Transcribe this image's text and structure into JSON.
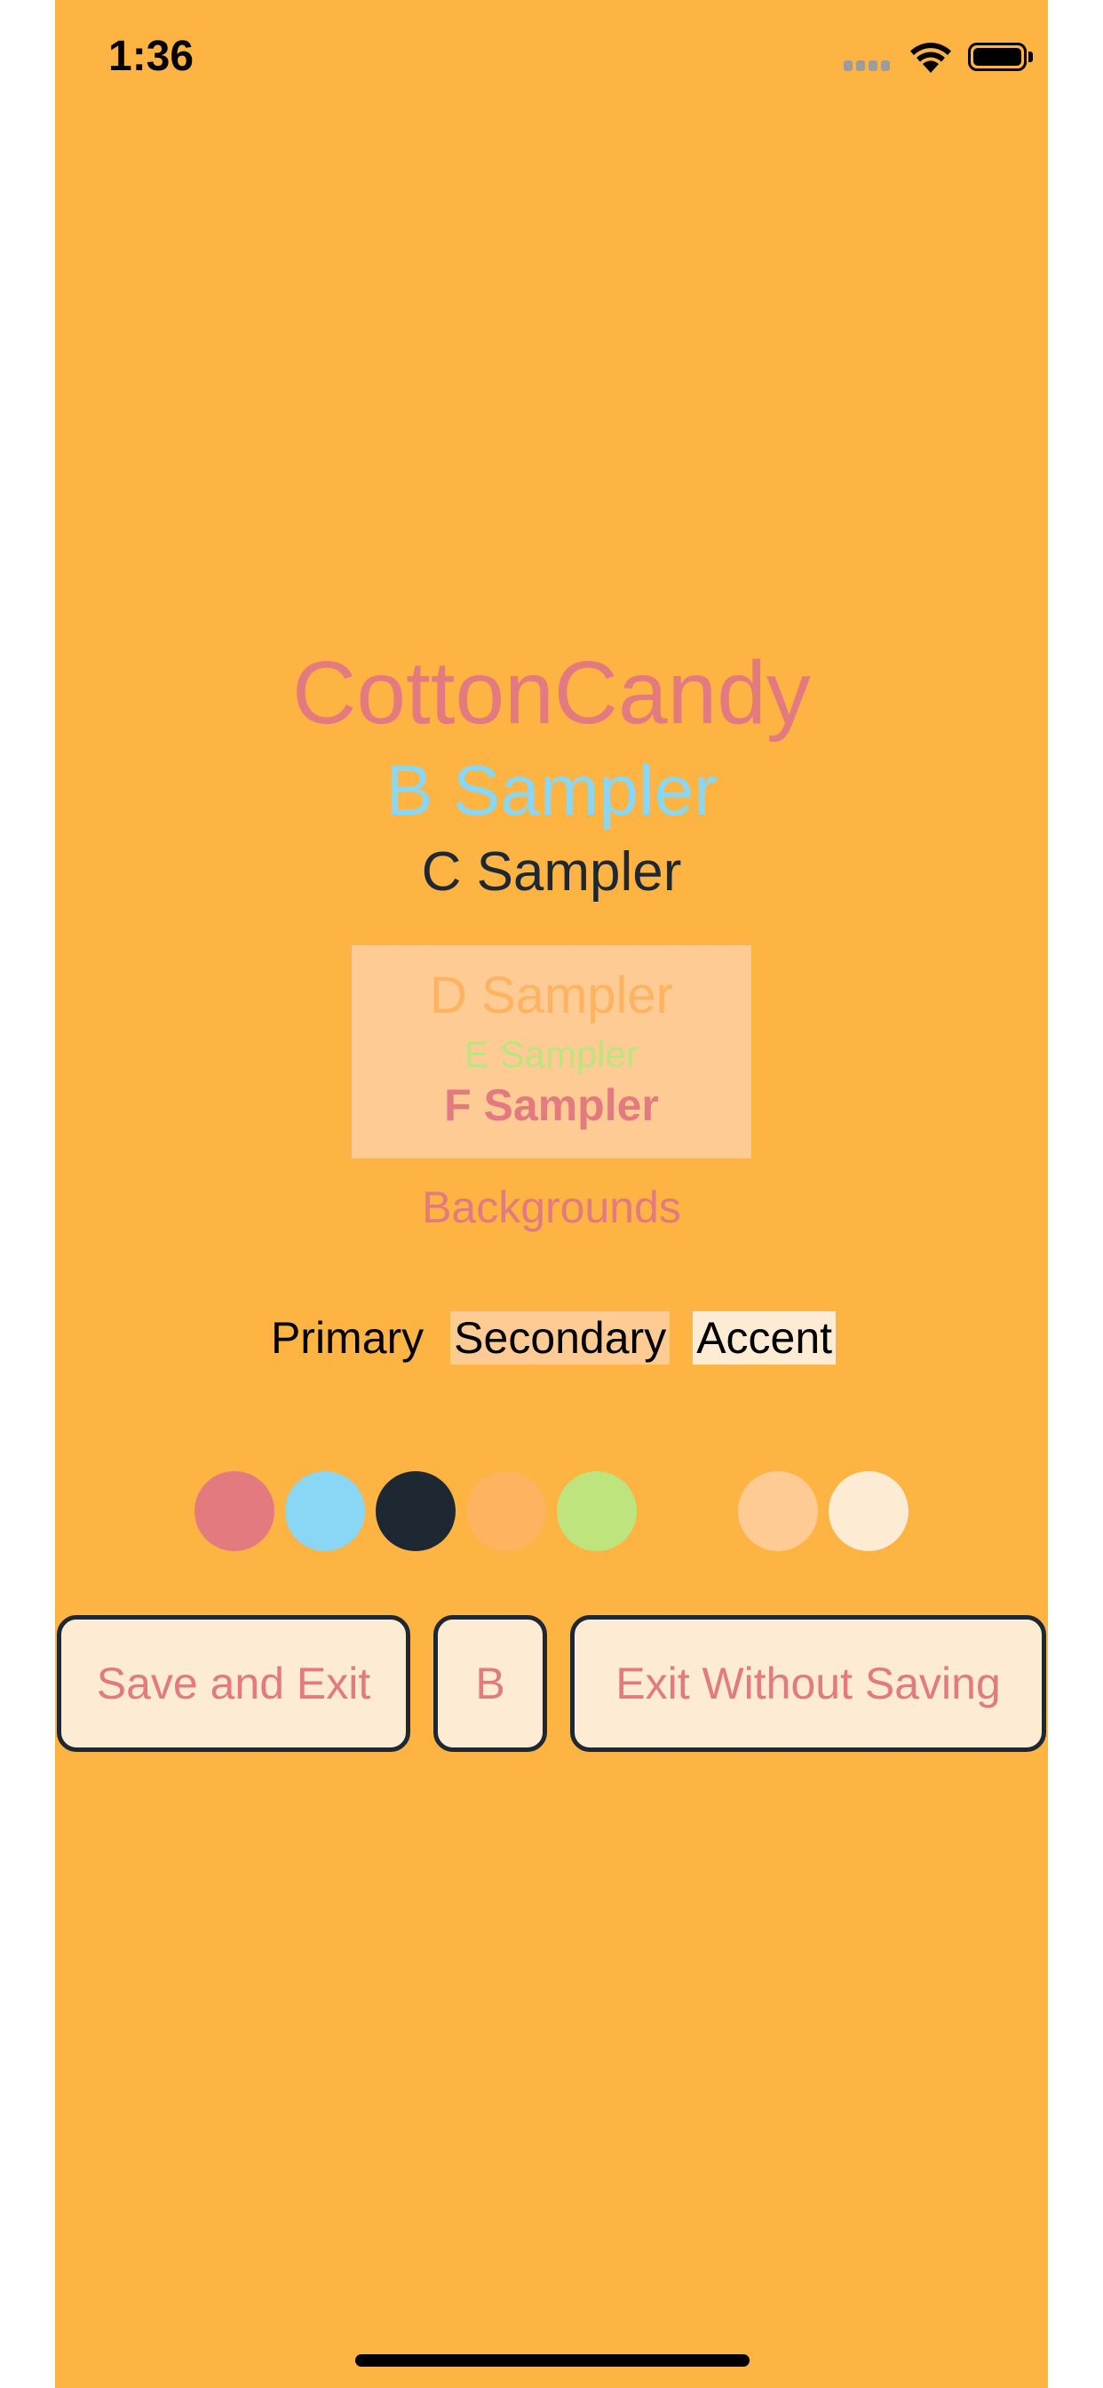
{
  "status_bar": {
    "time": "1:36"
  },
  "theme": {
    "title": "CottonCandy",
    "samplers": {
      "b": "B Sampler",
      "c": "C Sampler",
      "d": "D Sampler",
      "e": "E Sampler",
      "f": "F Sampler"
    },
    "backgrounds_heading": "Backgrounds",
    "backgrounds": {
      "primary": "Primary",
      "secondary": "Secondary",
      "accent": "Accent"
    }
  },
  "colors": {
    "screen_background": "#FDB442",
    "a": "#E27A80",
    "b": "#8AD6F5",
    "c": "#1E2833",
    "d": "#FDB35F",
    "e": "#BDE47D",
    "f": "#FDB442",
    "secondary": "#FECB95",
    "accent": "#FEEBD3"
  },
  "swatches": [
    {
      "name": "swatch-a",
      "color": "#E27A80"
    },
    {
      "name": "swatch-b",
      "color": "#8AD6F5"
    },
    {
      "name": "swatch-c",
      "color": "#1E2833"
    },
    {
      "name": "swatch-d",
      "color": "#FDB35F"
    },
    {
      "name": "swatch-e",
      "color": "#BDE47D"
    },
    {
      "name": "swatch-f",
      "color": "#FDB442"
    },
    {
      "name": "swatch-secondary",
      "color": "#FECB95"
    },
    {
      "name": "swatch-accent",
      "color": "#FEEBD3"
    }
  ],
  "buttons": {
    "save_and_exit": "Save and Exit",
    "b": "B",
    "exit_without_saving": "Exit Without Saving"
  }
}
